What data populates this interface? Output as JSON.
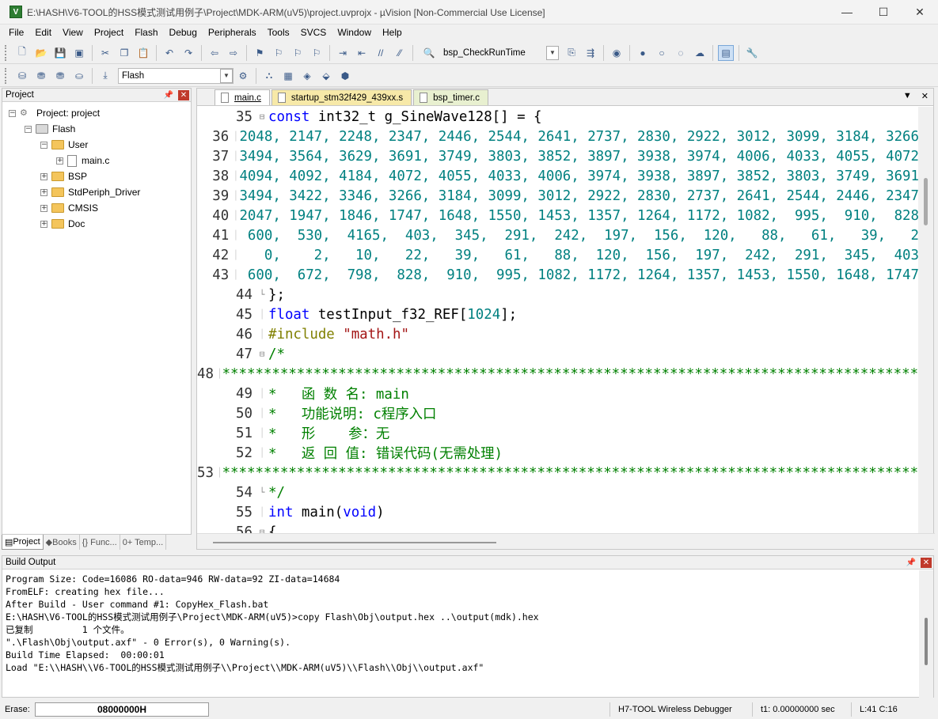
{
  "window": {
    "title": "E:\\HASH\\V6-TOOL的HSS模式测试用例子\\Project\\MDK-ARM(uV5)\\project.uvprojx - µVision [Non-Commercial Use License]",
    "min": "—",
    "max": "☐",
    "close": "✕"
  },
  "menu": [
    "File",
    "Edit",
    "View",
    "Project",
    "Flash",
    "Debug",
    "Peripherals",
    "Tools",
    "SVCS",
    "Window",
    "Help"
  ],
  "toolbar": {
    "find_target": "bsp_CheckRunTime",
    "build_target": "Flash"
  },
  "project_panel": {
    "title": "Project",
    "tree": [
      {
        "label": "Project: project",
        "level": 0,
        "expander": "⊟",
        "kind": "project"
      },
      {
        "label": "Flash",
        "level": 1,
        "expander": "⊟",
        "kind": "target"
      },
      {
        "label": "User",
        "level": 2,
        "expander": "⊟",
        "kind": "folder"
      },
      {
        "label": "main.c",
        "level": 3,
        "expander": "⊞",
        "kind": "file"
      },
      {
        "label": "BSP",
        "level": 2,
        "expander": "⊞",
        "kind": "folder"
      },
      {
        "label": "StdPeriph_Driver",
        "level": 2,
        "expander": "⊞",
        "kind": "folder"
      },
      {
        "label": "CMSIS",
        "level": 2,
        "expander": "⊞",
        "kind": "folder"
      },
      {
        "label": "Doc",
        "level": 2,
        "expander": "⊞",
        "kind": "folder"
      }
    ],
    "tabs": [
      "Project",
      "Books",
      "{} Func...",
      "0+ Temp..."
    ]
  },
  "editor": {
    "tabs": [
      {
        "label": "main.c",
        "style": "active"
      },
      {
        "label": "startup_stm32f429_439xx.s",
        "style": "yellow"
      },
      {
        "label": "bsp_timer.c",
        "style": "green"
      }
    ],
    "lines": [
      {
        "n": "35",
        "fold": "⊟",
        "segs": [
          [
            "kw",
            "const "
          ],
          [
            "t",
            "int32_t g_SineWave128[] = {"
          ]
        ]
      },
      {
        "n": "36",
        "fold": "",
        "segs": [
          [
            "num",
            "2048, 2147, 2248, 2347, 2446, 2544, 2641, 2737, 2830, 2922, 3012, 3099, 3184, 3266"
          ]
        ]
      },
      {
        "n": "37",
        "fold": "",
        "segs": [
          [
            "num",
            "3494, 3564, 3629, 3691, 3749, 3803, 3852, 3897, 3938, 3974, 4006, 4033, 4055, 4072"
          ]
        ]
      },
      {
        "n": "38",
        "fold": "",
        "segs": [
          [
            "num",
            "4094, 4092, 4184, 4072, 4055, 4033, 4006, 3974, 3938, 3897, 3852, 3803, 3749, 3691"
          ]
        ]
      },
      {
        "n": "39",
        "fold": "",
        "segs": [
          [
            "num",
            "3494, 3422, 3346, 3266, 3184, 3099, 3012, 2922, 2830, 2737, 2641, 2544, 2446, 2347"
          ]
        ]
      },
      {
        "n": "40",
        "fold": "",
        "segs": [
          [
            "num",
            "2047, 1947, 1846, 1747, 1648, 1550, 1453, 1357, 1264, 1172, 1082,  995,  910,  828"
          ]
        ]
      },
      {
        "n": "41",
        "fold": "",
        "segs": [
          [
            "num",
            " 600,  530,  4165,  403,  345,  291,  242,  197,  156,  120,   88,   61,   39,   2"
          ]
        ]
      },
      {
        "n": "42",
        "fold": "",
        "segs": [
          [
            "num",
            "   0,    2,   10,   22,   39,   61,   88,  120,  156,  197,  242,  291,  345,  403"
          ]
        ]
      },
      {
        "n": "43",
        "fold": "",
        "segs": [
          [
            "num",
            " 600,  672,  798,  828,  910,  995, 1082, 1172, 1264, 1357, 1453, 1550, 1648, 1747"
          ]
        ]
      },
      {
        "n": "44",
        "fold": "└",
        "segs": [
          [
            "t",
            "};"
          ]
        ]
      },
      {
        "n": "45",
        "fold": "",
        "segs": [
          [
            "kw",
            "float "
          ],
          [
            "t",
            "testInput_f32_REF["
          ],
          [
            "num",
            "1024"
          ],
          [
            "t",
            "];"
          ]
        ]
      },
      {
        "n": "46",
        "fold": "",
        "segs": [
          [
            "pp",
            "#include "
          ],
          [
            "str",
            "\"math.h\""
          ]
        ]
      },
      {
        "n": "47",
        "fold": "⊟",
        "segs": [
          [
            "cmt",
            "/*"
          ]
        ]
      },
      {
        "n": "48",
        "fold": "",
        "segs": [
          [
            "cmt",
            "*****************************************************************************************"
          ]
        ]
      },
      {
        "n": "49",
        "fold": "",
        "segs": [
          [
            "cmt",
            "*   函 数 名: main"
          ]
        ]
      },
      {
        "n": "50",
        "fold": "",
        "segs": [
          [
            "cmt",
            "*   功能说明: c程序入口"
          ]
        ]
      },
      {
        "n": "51",
        "fold": "",
        "segs": [
          [
            "cmt",
            "*   形    参：无"
          ]
        ]
      },
      {
        "n": "52",
        "fold": "",
        "segs": [
          [
            "cmt",
            "*   返 回 值: 错误代码(无需处理)"
          ]
        ]
      },
      {
        "n": "53",
        "fold": "",
        "segs": [
          [
            "cmt",
            "*****************************************************************************************"
          ]
        ]
      },
      {
        "n": "54",
        "fold": "└",
        "segs": [
          [
            "cmt",
            "*/"
          ]
        ]
      },
      {
        "n": "55",
        "fold": "",
        "segs": [
          [
            "kw",
            "int "
          ],
          [
            "t",
            "main("
          ],
          [
            "kw",
            "void"
          ],
          [
            "t",
            ")"
          ]
        ]
      },
      {
        "n": "56",
        "fold": "⊟",
        "segs": [
          [
            "t",
            "{"
          ]
        ]
      }
    ]
  },
  "build_output": {
    "title": "Build Output",
    "lines": [
      "Program Size: Code=16086 RO-data=946 RW-data=92 ZI-data=14684",
      "FromELF: creating hex file...",
      "After Build - User command #1: CopyHex_Flash.bat",
      "E:\\HASH\\V6-TOOL的HSS模式测试用例子\\Project\\MDK-ARM(uV5)>copy Flash\\Obj\\output.hex ..\\output(mdk).hex",
      "已复制         1 个文件。",
      "\".\\Flash\\Obj\\output.axf\" - 0 Error(s), 0 Warning(s).",
      "Build Time Elapsed:  00:00:01",
      "Load \"E:\\\\HASH\\\\V6-TOOL的HSS模式测试用例子\\\\Project\\\\MDK-ARM(uV5)\\\\Flash\\\\Obj\\\\output.axf\""
    ]
  },
  "status": {
    "erase_label": "Erase:",
    "address": "08000000H",
    "debugger": "H7-TOOL Wireless Debugger",
    "time": "t1: 0.00000000 sec",
    "position": "L:41 C:16"
  },
  "colors": {
    "keyword": "#0000ff",
    "number": "#008080",
    "comment": "#008000",
    "string": "#a31515",
    "preproc": "#808000"
  }
}
